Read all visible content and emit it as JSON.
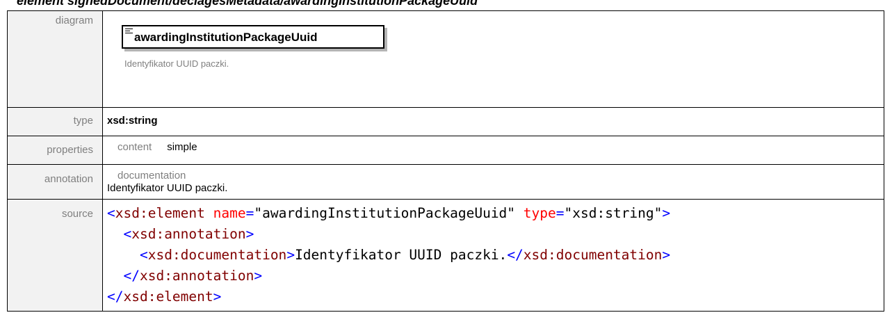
{
  "heading": "element signedDocument/declagesMetadata/awardingInstitutionPackageUuid",
  "rows": {
    "diagram": {
      "label": "diagram",
      "element_name": "awardingInstitutionPackageUuid",
      "element_doc": "Identyfikator UUID paczki."
    },
    "type": {
      "label": "type",
      "value": "xsd:string"
    },
    "properties": {
      "label": "properties",
      "key": "content",
      "value": "simple"
    },
    "annotation": {
      "label": "annotation",
      "key": "documentation",
      "value": "Identyfikator UUID paczki."
    },
    "source": {
      "label": "source",
      "line1": {
        "open": "<",
        "tag": "xsd:element",
        "attr1_name": "name",
        "eq1": "=",
        "attr1_value": "\"awardingInstitutionPackageUuid\"",
        "attr2_name": "type",
        "eq2": "=",
        "attr2_value": "\"xsd:string\"",
        "close": ">"
      },
      "line2": {
        "open": "<",
        "tag": "xsd:annotation",
        "close": ">"
      },
      "line3": {
        "open": "<",
        "tag": "xsd:documentation",
        "close": ">",
        "text": "Identyfikator UUID paczki.",
        "end_open": "</",
        "end_tag": "xsd:documentation",
        "end_close": ">"
      },
      "line4": {
        "open": "</",
        "tag": "xsd:annotation",
        "close": ">"
      },
      "line5": {
        "open": "</",
        "tag": "xsd:element",
        "close": ">"
      }
    }
  }
}
